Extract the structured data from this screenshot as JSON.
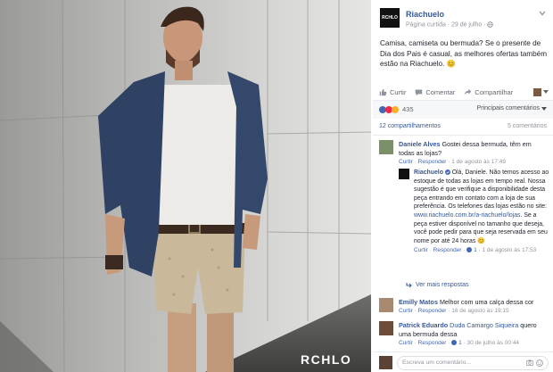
{
  "photo": {
    "logo_text": "RCHLO",
    "alt": ""
  },
  "post": {
    "page_name": "Riachuelo",
    "page_logo_text": "RCHLO",
    "meta": "Página curtida · 29 de julho · ",
    "text": "Camisa, camiseta ou bermuda? Se o presente de Dia dos Pais é casual, as melhores ofertas também estão na Riachuelo. 😊"
  },
  "actions": {
    "like": "Curtir",
    "comment": "Comentar",
    "share": "Compartilhar"
  },
  "reactions": {
    "count": "435",
    "filter": "Principais comentários"
  },
  "stats": {
    "shares": "12 compartilhamentos",
    "comments": "5 comentários"
  },
  "comments": [
    {
      "name": "Daniele Alves",
      "text": "Gostei dessa bermuda, têm em todas as lojas?",
      "like": "Curtir",
      "reply": "Responder",
      "time": "1 de agosto às 17:49"
    },
    {
      "name": "Riachuelo",
      "text": "Olá, Daniele. Não temos acesso ao estoque de todas as lojas em tempo real. Nossa sugestão é que verifique a disponibilidade desta peça entrando em contato com a loja de sua preferência. Os telefones das lojas estão no site:",
      "link": "www.riachuelo.com.br/a-riachuelo/lojas",
      "text2": ". Se a peça estiver disponível no tamanho que deseja, você pode pedir para que seja reservada em seu nome por até 24 horas 😊",
      "like": "Curtir",
      "reply": "Responder",
      "likes": "1",
      "time": "1 de agosto às 17:53"
    },
    {
      "name": "Emilly Matos",
      "text": "Melhor com uma calça dessa cor",
      "like": "Curtir",
      "reply": "Responder",
      "time": "16 de agosto às 19:15"
    },
    {
      "name": "Patrick Eduardo",
      "tag": "Duda Camargo Siqueira",
      "text": "quero uma bermuda dessa",
      "like": "Curtir",
      "reply": "Responder",
      "likes": "1",
      "time": "30 de julho às 00:44"
    }
  ],
  "more_replies": "Ver mais respostas",
  "composer": {
    "placeholder": "Escreva um comentário..."
  },
  "colors": {
    "link": "#365899",
    "muted": "#90949c",
    "like_blue": "#4267b2"
  }
}
